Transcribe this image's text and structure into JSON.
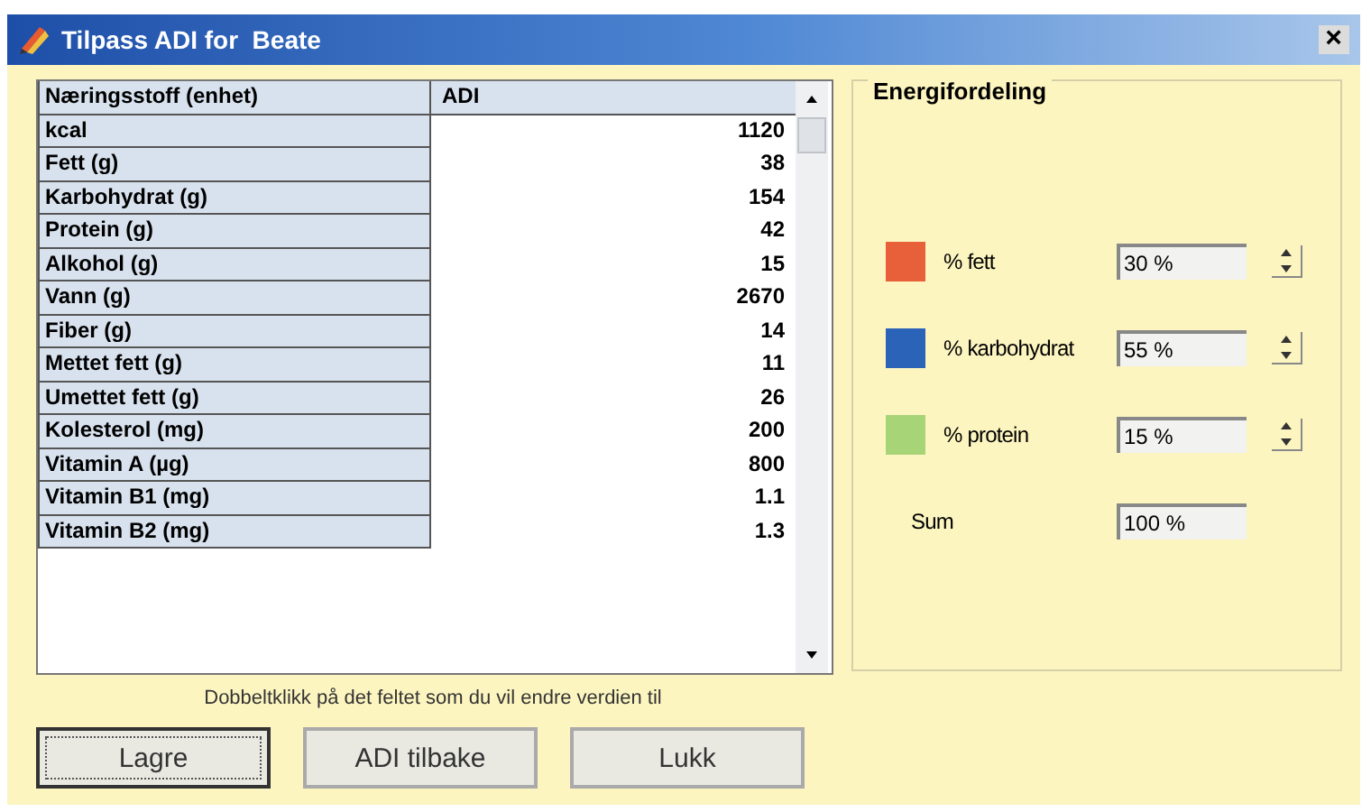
{
  "window": {
    "title": "Tilpass ADI for  Beate",
    "close": "×"
  },
  "table": {
    "columns": [
      "Næringsstoff (enhet)",
      "ADI"
    ],
    "rows": [
      {
        "name": "kcal",
        "value": "1120"
      },
      {
        "name": "Fett (g)",
        "value": "38"
      },
      {
        "name": "Karbohydrat (g)",
        "value": "154"
      },
      {
        "name": "Protein (g)",
        "value": "42"
      },
      {
        "name": "Alkohol (g)",
        "value": "15"
      },
      {
        "name": "Vann (g)",
        "value": "2670"
      },
      {
        "name": "Fiber (g)",
        "value": "14"
      },
      {
        "name": "Mettet fett (g)",
        "value": "11"
      },
      {
        "name": "Umettet fett (g)",
        "value": "26"
      },
      {
        "name": "Kolesterol (mg)",
        "value": "200"
      },
      {
        "name": "Vitamin A (µg)",
        "value": "800"
      },
      {
        "name": "Vitamin B1 (mg)",
        "value": "1.1"
      },
      {
        "name": "Vitamin B2 (mg)",
        "value": "1.3"
      }
    ]
  },
  "energy": {
    "title": "Energifordeling",
    "items": [
      {
        "label": "% fett",
        "value": "30 %",
        "color": "#e8603a"
      },
      {
        "label": "% karbohydrat",
        "value": "55 %",
        "color": "#2a63b8"
      },
      {
        "label": "% protein",
        "value": "15 %",
        "color": "#a8d478"
      }
    ],
    "sum": {
      "label": "Sum",
      "value": "100 %"
    }
  },
  "hint": "Dobbeltklikk på det feltet som du vil endre verdien til",
  "buttons": [
    {
      "label": "Lagre",
      "default": true
    },
    {
      "label": "ADI tilbake",
      "default": false
    },
    {
      "label": "Lukk",
      "default": false
    }
  ]
}
